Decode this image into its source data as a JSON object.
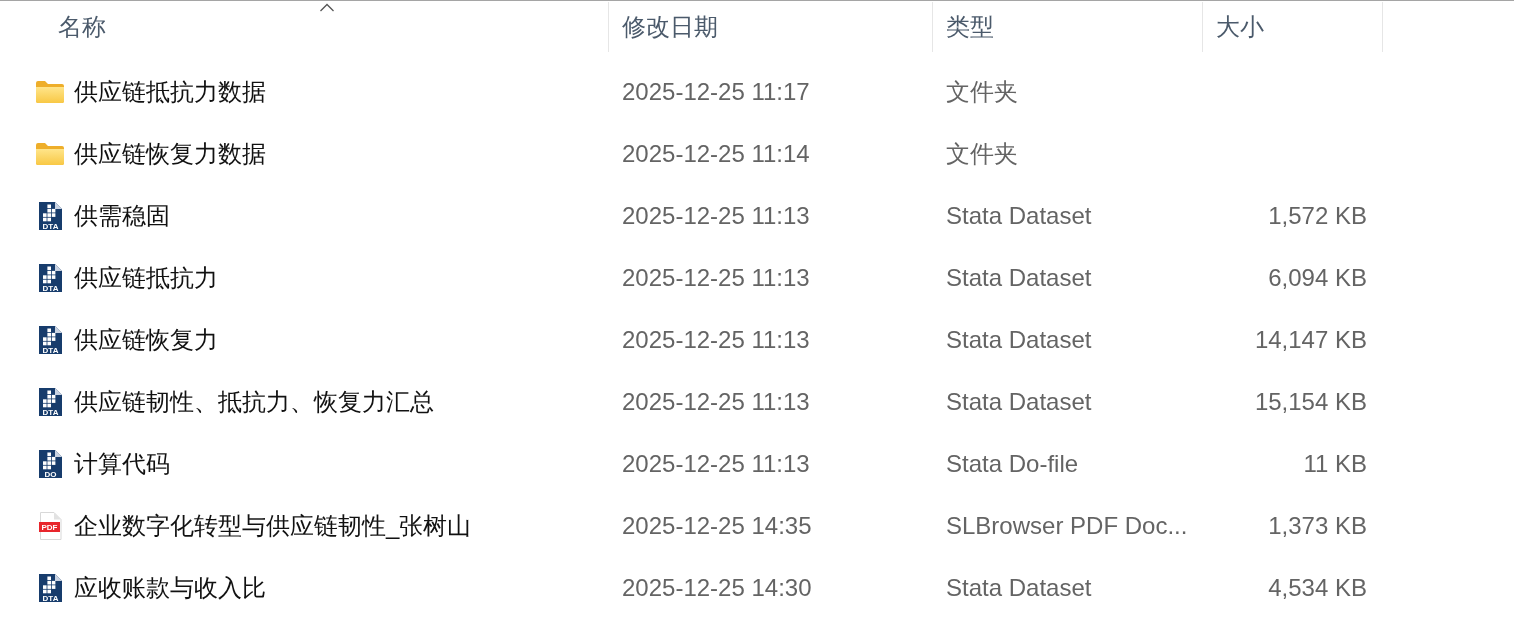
{
  "columns": [
    {
      "label": "名称",
      "sorted": true
    },
    {
      "label": "修改日期",
      "sorted": false
    },
    {
      "label": "类型",
      "sorted": false
    },
    {
      "label": "大小",
      "sorted": false
    }
  ],
  "rows": [
    {
      "kind": "folder",
      "name": "供应链抵抗力数据",
      "modified": "2025-12-25 11:17",
      "type": "文件夹"
    },
    {
      "kind": "folder",
      "name": "供应链恢复力数据",
      "modified": "2025-12-25 11:14",
      "type": "文件夹"
    },
    {
      "kind": "stata",
      "icon_label": "DTA",
      "name": "供需稳固",
      "modified": "2025-12-25 11:13",
      "type": "Stata Dataset",
      "size": "1,572 KB"
    },
    {
      "kind": "stata",
      "icon_label": "DTA",
      "name": "供应链抵抗力",
      "modified": "2025-12-25 11:13",
      "type": "Stata Dataset",
      "size": "6,094 KB"
    },
    {
      "kind": "stata",
      "icon_label": "DTA",
      "name": "供应链恢复力",
      "modified": "2025-12-25 11:13",
      "type": "Stata Dataset",
      "size": "14,147 KB"
    },
    {
      "kind": "stata",
      "icon_label": "DTA",
      "name": "供应链韧性、抵抗力、恢复力汇总",
      "modified": "2025-12-25 11:13",
      "type": "Stata Dataset",
      "size": "15,154 KB"
    },
    {
      "kind": "stata",
      "icon_label": "DO",
      "name": "计算代码",
      "modified": "2025-12-25 11:13",
      "type": "Stata Do-file",
      "size": "11 KB"
    },
    {
      "kind": "pdf",
      "icon_label": "PDF",
      "name": "企业数字化转型与供应链韧性_张树山",
      "modified": "2025-12-25 14:35",
      "type": "SLBrowser PDF Doc...",
      "size": "1,373 KB"
    },
    {
      "kind": "stata",
      "icon_label": "DTA",
      "name": "应收账款与收入比",
      "modified": "2025-12-25 14:30",
      "type": "Stata Dataset",
      "size": "4,534 KB"
    }
  ]
}
